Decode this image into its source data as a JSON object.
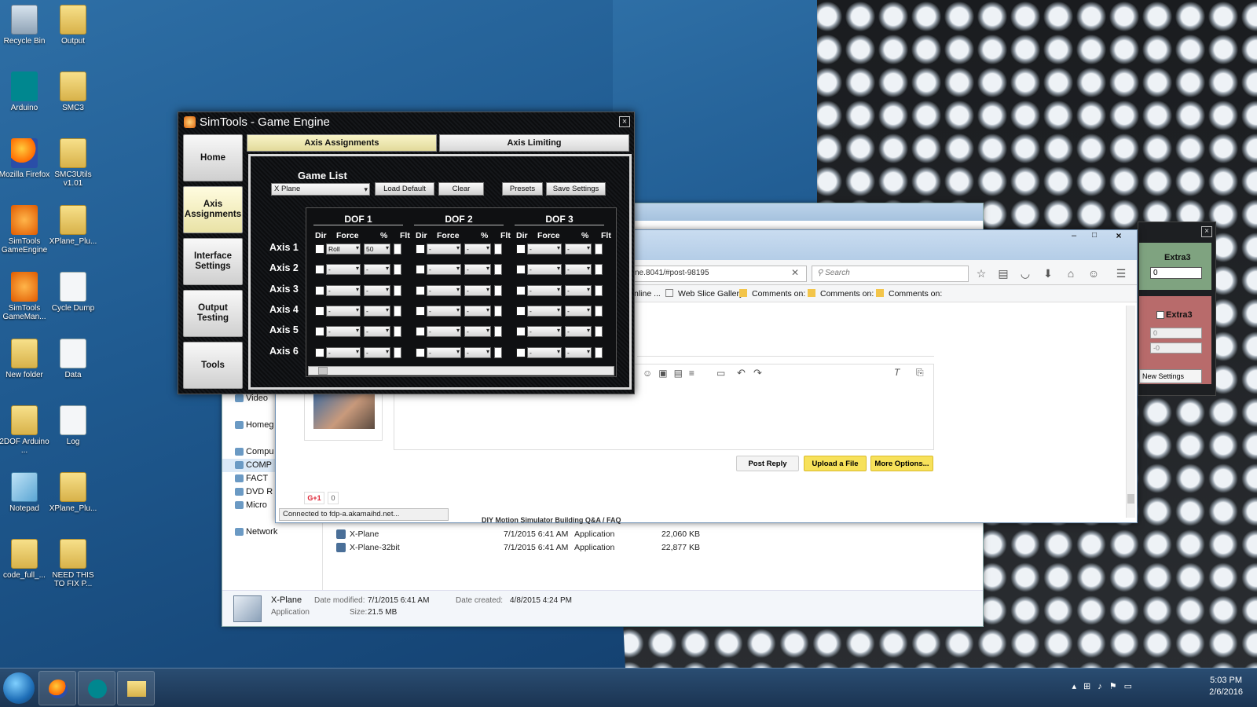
{
  "desktop": {
    "icons": [
      {
        "label": "Recycle Bin",
        "icon": "recycle-bin-icon"
      },
      {
        "label": "Output",
        "icon": "folder-icon"
      },
      {
        "label": "Arduino",
        "icon": "arduino-icon"
      },
      {
        "label": "SMC3",
        "icon": "folder-icon"
      },
      {
        "label": "Mozilla Firefox",
        "icon": "firefox-icon"
      },
      {
        "label": "SMC3Utils v1.01",
        "icon": "folder-icon"
      },
      {
        "label": "SimTools GameEngine",
        "icon": "simtools-icon"
      },
      {
        "label": "XPlane_Plu...",
        "icon": "folder-icon"
      },
      {
        "label": "SimTools GameMan...",
        "icon": "simtools-icon"
      },
      {
        "label": "Cycle Dump",
        "icon": "document-icon"
      },
      {
        "label": "New folder",
        "icon": "folder-icon"
      },
      {
        "label": "Data",
        "icon": "document-icon"
      },
      {
        "label": "2DOF Arduino ...",
        "icon": "folder-icon"
      },
      {
        "label": "Log",
        "icon": "document-icon"
      },
      {
        "label": "Notepad",
        "icon": "notepad-icon"
      },
      {
        "label": "XPlane_Plu...",
        "icon": "folder-icon"
      },
      {
        "label": "code_full_...",
        "icon": "folder-icon"
      },
      {
        "label": "NEED THIS TO FIX P...",
        "icon": "folder-icon"
      }
    ]
  },
  "simtools": {
    "title": "SimTools - Game Engine",
    "close": "×",
    "sidebar": [
      "Home",
      "Axis Assignments",
      "Interface Settings",
      "Output Testing",
      "Tools"
    ],
    "tabs": [
      "Axis Assignments",
      "Axis Limiting"
    ],
    "game_list_label": "Game List",
    "game_selected": "X Plane",
    "buttons": {
      "load_default": "Load Default",
      "clear": "Clear",
      "presets": "Presets",
      "save_settings": "Save Settings"
    },
    "dof_headers": [
      "DOF 1",
      "DOF 2",
      "DOF 3"
    ],
    "col_headers": [
      "Dir",
      "Force",
      "%",
      "Flt"
    ],
    "axes": [
      "Axis 1",
      "Axis 2",
      "Axis 3",
      "Axis 4",
      "Axis 5",
      "Axis 6"
    ],
    "axis1_force": "Roll",
    "axis1_pct": "50",
    "empty": "-"
  },
  "browser": {
    "url": "ne.8041/#post-98195",
    "search_placeholder": "Search",
    "bookmarks": [
      "nline ...",
      "Web Slice Gallery",
      "Comments on:",
      "Comments on:",
      "Comments on:"
    ],
    "post_reply": "Post Reply",
    "upload_file": "Upload a File",
    "more_options": "More Options...",
    "gplus": "G+1",
    "gplus_count": "0",
    "status": "Connected to fdp-a.akamaihd.net...",
    "crumb": "DIY Motion Simulator Building Q&A / FAQ"
  },
  "explorer": {
    "nav": [
      "Video",
      "Homeg",
      "Compu",
      "COMP",
      "FACT",
      "DVD R",
      "Micro",
      "Network"
    ],
    "files": [
      {
        "name": "X-Plane",
        "date": "7/1/2015 6:41 AM",
        "type": "Application",
        "size": "22,060 KB"
      },
      {
        "name": "X-Plane-32bit",
        "date": "7/1/2015 6:41 AM",
        "type": "Application",
        "size": "22,877 KB"
      }
    ],
    "details": {
      "name": "X-Plane",
      "type": "Application",
      "modified_label": "Date modified:",
      "modified": "7/1/2015 6:41 AM",
      "size_label": "Size:",
      "size": "21.5 MB",
      "created_label": "Date created:",
      "created": "4/8/2015 4:24 PM"
    }
  },
  "sidepanel": {
    "extra3a": "Extra3",
    "val_a": "0",
    "extra3b": "Extra3",
    "val_b1": "0",
    "val_b2": "-0",
    "new_settings": "New Settings"
  },
  "taskbar": {
    "time": "5:03 PM",
    "date": "2/6/2016"
  }
}
